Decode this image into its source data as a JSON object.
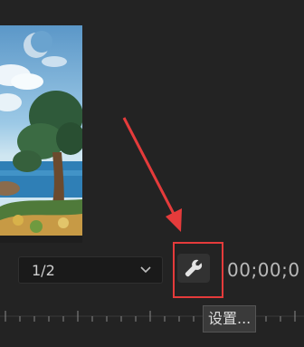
{
  "resolution_select": {
    "value": "1/2"
  },
  "settings_button": {
    "icon": "wrench-icon",
    "tooltip": "设置..."
  },
  "timecode": {
    "value": "00;00;0"
  },
  "annotation": {
    "color": "#e53b3b"
  }
}
